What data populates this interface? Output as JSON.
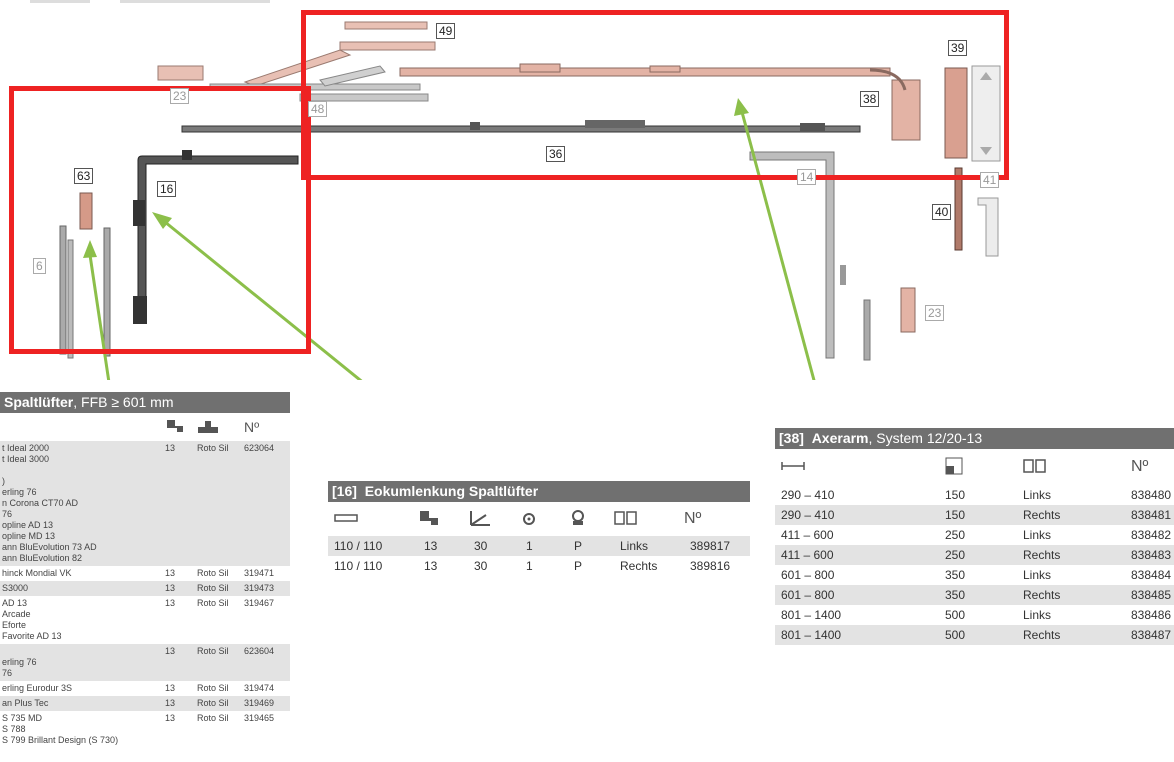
{
  "callouts": {
    "c49": "49",
    "c23a": "23",
    "c48": "48",
    "c39": "39",
    "c38": "38",
    "c36": "36",
    "c63": "63",
    "c16": "16",
    "c6": "6",
    "c14": "14",
    "c41": "41",
    "c40": "40",
    "c23b": "23"
  },
  "colors": {
    "highlight": "#ee2222",
    "arrow": "#8cbf4a",
    "header": "#707070",
    "shade": "#e3e3e3"
  },
  "table1": {
    "title_bold": "Spaltlüfter",
    "title_rest": ", FFB ≥ 601 mm",
    "no_symbol": "Nº",
    "rows": [
      {
        "name": "t Ideal 2000\nt Ideal 3000\n\n)\nerling 76\nn Corona CT70 AD\n76\nopline AD 13\nopline MD 13\nann BluEvolution 73 AD\nann BluEvolution 82",
        "n13": "13",
        "mat": "Roto Sil",
        "no": "623064",
        "shade": true
      },
      {
        "name": "hinck Mondial VK",
        "n13": "13",
        "mat": "Roto Sil",
        "no": "319471",
        "shade": false
      },
      {
        "name": "S3000",
        "n13": "13",
        "mat": "Roto Sil",
        "no": "319473",
        "shade": true
      },
      {
        "name": "AD 13\nArcade\nEforte\nFavorite AD 13",
        "n13": "13",
        "mat": "Roto Sil",
        "no": "319467",
        "shade": false
      },
      {
        "name": "\nerling 76\n76",
        "n13": "13",
        "mat": "Roto Sil",
        "no": "623604",
        "shade": true
      },
      {
        "name": "erling Eurodur 3S",
        "n13": "13",
        "mat": "Roto Sil",
        "no": "319474",
        "shade": false
      },
      {
        "name": "an Plus Tec",
        "n13": "13",
        "mat": "Roto Sil",
        "no": "319469",
        "shade": true
      },
      {
        "name": "S 735 MD\nS 788\nS 799 Brillant Design (S 730)",
        "n13": "13",
        "mat": "Roto Sil",
        "no": "319465",
        "shade": false
      }
    ]
  },
  "table2": {
    "title_num": "[16]",
    "title_bold": "Eokumlenkung Spaltlüfter",
    "no_symbol": "Nº",
    "rows": [
      {
        "size": "110 / 110",
        "a": "13",
        "b": "30",
        "c": "1",
        "d": "P",
        "side": "Links",
        "no": "389817",
        "shade": true
      },
      {
        "size": "110 / 110",
        "a": "13",
        "b": "30",
        "c": "1",
        "d": "P",
        "side": "Rechts",
        "no": "389816",
        "shade": false
      }
    ]
  },
  "table3": {
    "title_num": "[38]",
    "title_bold": "Axerarm",
    "title_rest": ", System 12/20-13",
    "no_symbol": "Nº",
    "rows": [
      {
        "range": "290 – 410",
        "size": "150",
        "side": "Links",
        "no": "838480",
        "shade": false
      },
      {
        "range": "290 – 410",
        "size": "150",
        "side": "Rechts",
        "no": "838481",
        "shade": true
      },
      {
        "range": "411 – 600",
        "size": "250",
        "side": "Links",
        "no": "838482",
        "shade": false
      },
      {
        "range": "411 – 600",
        "size": "250",
        "side": "Rechts",
        "no": "838483",
        "shade": true
      },
      {
        "range": "601 – 800",
        "size": "350",
        "side": "Links",
        "no": "838484",
        "shade": false
      },
      {
        "range": "601 – 800",
        "size": "350",
        "side": "Rechts",
        "no": "838485",
        "shade": true
      },
      {
        "range": "801 – 1400",
        "size": "500",
        "side": "Links",
        "no": "838486",
        "shade": false
      },
      {
        "range": "801 – 1400",
        "size": "500",
        "side": "Rechts",
        "no": "838487",
        "shade": true
      }
    ]
  }
}
